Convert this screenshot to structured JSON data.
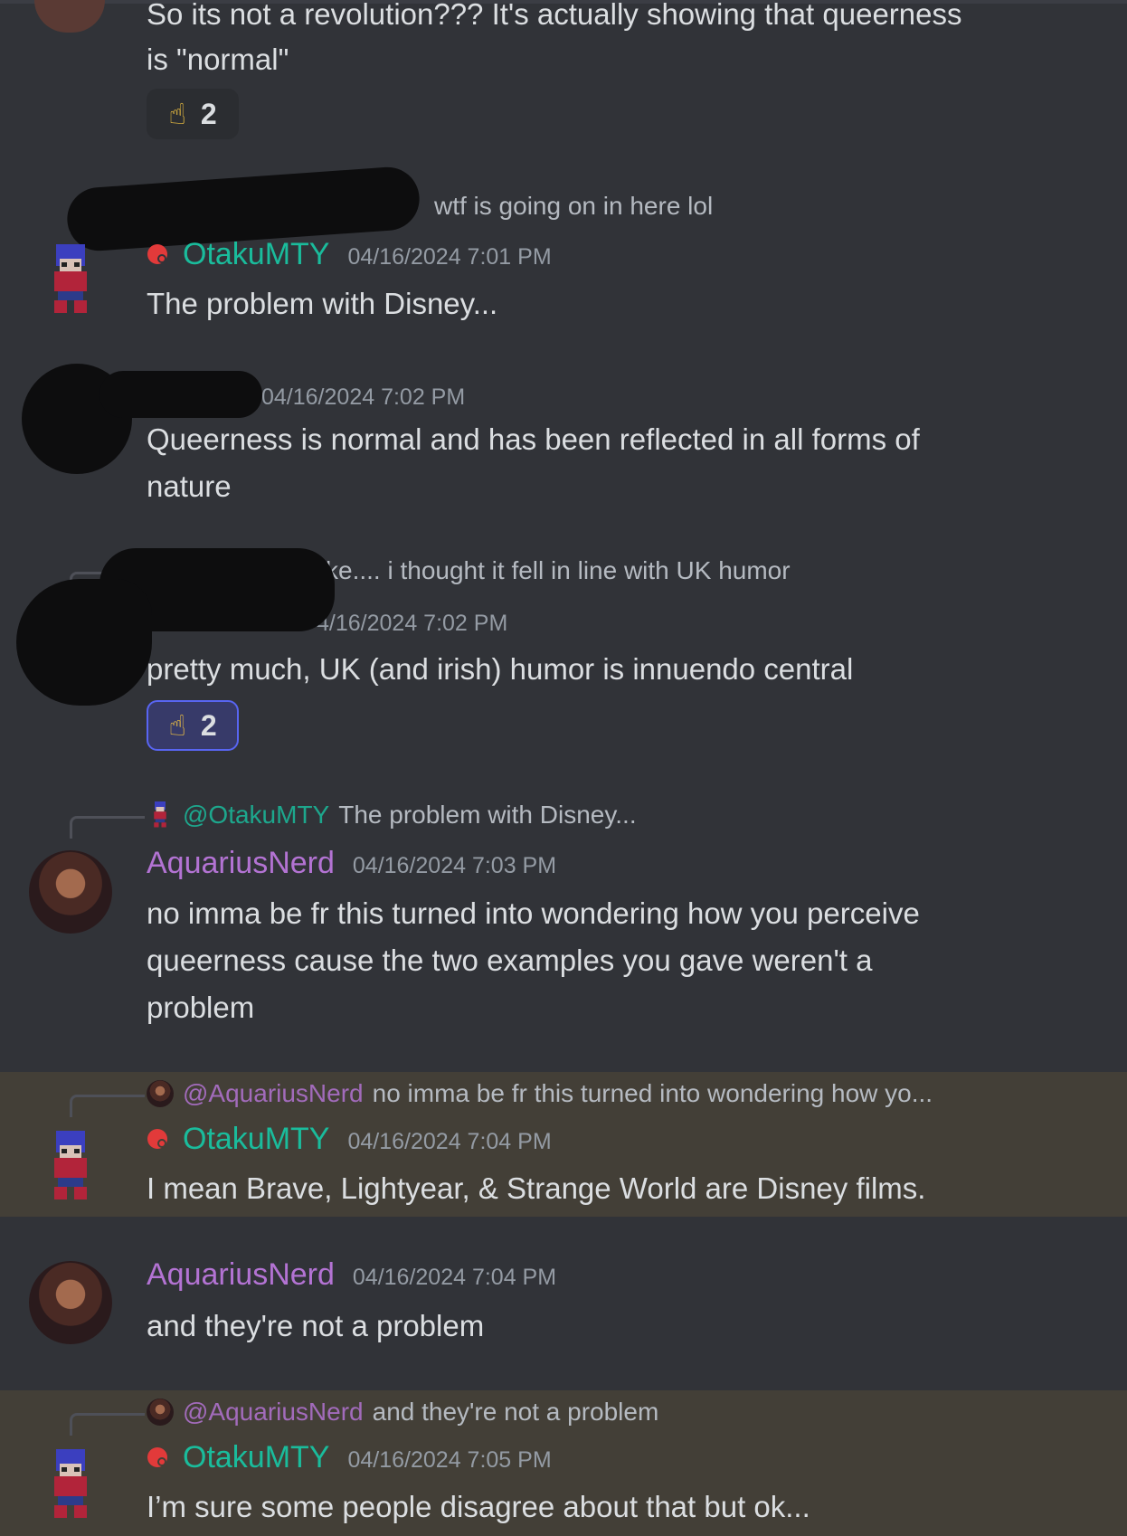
{
  "messages": [
    {
      "lines": [
        "So its not a revolution??? It's actually showing that queerness",
        "is \"normal\""
      ],
      "reaction": {
        "emoji": "☝",
        "count": "2"
      }
    },
    {
      "reply": {
        "snippet": "wtf is going on in here lol"
      },
      "author": "OtakuMTY",
      "timestamp": "04/16/2024 7:01 PM",
      "lines": [
        "The problem with Disney..."
      ]
    },
    {
      "timestamp": "04/16/2024 7:02 PM",
      "lines": [
        "Queerness is normal and has been reflected in all forms of",
        "nature"
      ]
    },
    {
      "reply": {
        "snippet": "ke.... i thought it fell in line with UK humor"
      },
      "timestamp": "4/16/2024 7:02 PM",
      "lines": [
        "pretty much, UK (and irish) humor is innuendo central"
      ],
      "reaction": {
        "emoji": "☝",
        "count": "2"
      }
    },
    {
      "reply": {
        "mention": "@OtakuMTY",
        "snippet": "The problem with Disney..."
      },
      "author": "AquariusNerd",
      "timestamp": "04/16/2024 7:03 PM",
      "lines": [
        "no imma be fr this turned into wondering how you perceive",
        "queerness cause the two examples you gave weren't a",
        "problem"
      ]
    },
    {
      "reply": {
        "mention": "@AquariusNerd",
        "snippet": "no imma be fr this turned into wondering how yo..."
      },
      "author": "OtakuMTY",
      "timestamp": "04/16/2024 7:04 PM",
      "lines": [
        "I mean Brave, Lightyear, & Strange World are Disney films."
      ]
    },
    {
      "author": "AquariusNerd",
      "timestamp": "04/16/2024 7:04 PM",
      "lines": [
        "and they're not a problem"
      ]
    },
    {
      "reply": {
        "mention": "@AquariusNerd",
        "snippet": "and they're not a problem"
      },
      "author": "OtakuMTY",
      "timestamp": "04/16/2024 7:05 PM",
      "lines": [
        "I’m sure some people disagree about that but ok..."
      ]
    }
  ],
  "colors": {
    "otaku": "#1abc9c",
    "aquarius": "#b373d3",
    "highlight": "#433f37",
    "background": "#313338"
  },
  "icons": {
    "role": "red-role-badge-icon",
    "reaction": "pointing-up-finger-emoji"
  }
}
